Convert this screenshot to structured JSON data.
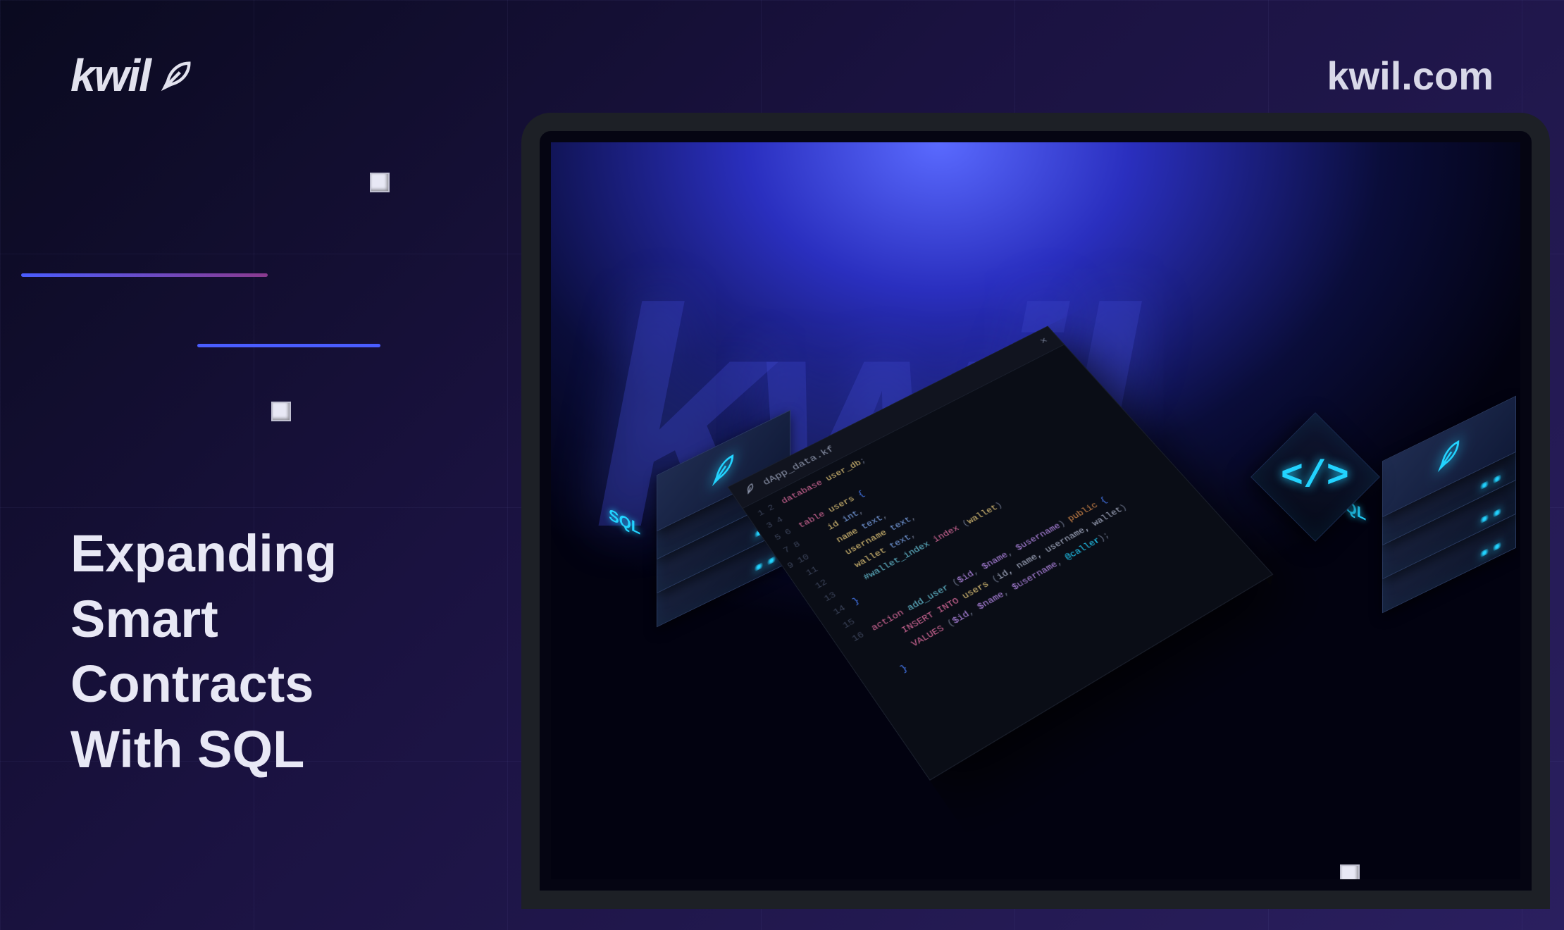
{
  "brand": {
    "name": "kwil",
    "url": "kwil.com"
  },
  "headline": {
    "line1": "Expanding",
    "line2": "Smart",
    "line3": "Contracts",
    "line4": "With SQL"
  },
  "db": {
    "label": "SQL"
  },
  "code_tag": {
    "glyph": "</>"
  },
  "editor": {
    "filename": "dApp_data.kf",
    "close_glyph": "×",
    "code": {
      "l1_kw": "database",
      "l1_id": "user_db",
      "l3_kw": "table",
      "l3_id": "users",
      "l4_id": "id",
      "l4_ty": "int",
      "l5_id": "name",
      "l5_ty": "text",
      "l6_id": "username",
      "l6_ty": "text",
      "l7_id": "wallet",
      "l7_ty": "text",
      "l8_idx": "#wallet_index",
      "l8_kw": "index",
      "l8_col": "wallet",
      "l11_kw": "action",
      "l11_fn": "add_user",
      "l11_p1": "$id",
      "l11_p2": "$name",
      "l11_p3": "$username",
      "l11_mod": "public",
      "l12_kw": "INSERT INTO",
      "l12_tbl": "users",
      "l12_cols": "id, name, username, wallet",
      "l13_kw": "VALUES",
      "l13_v1": "$id",
      "l13_v2": "$name",
      "l13_v3": "$username",
      "l13_caller": "@caller"
    }
  }
}
